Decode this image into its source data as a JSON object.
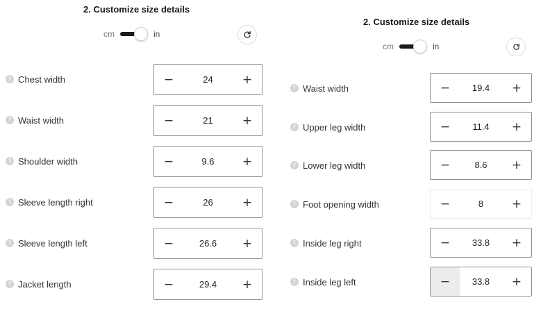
{
  "left": {
    "title": "2. Customize size details",
    "toggle": {
      "left_unit": "cm",
      "right_unit": "in",
      "selected": "in"
    },
    "reset_icon": "refresh-icon",
    "info_icon": "info-icon",
    "fields": [
      {
        "label": "Chest width",
        "value": "24",
        "minus": "−",
        "plus": "+"
      },
      {
        "label": "Waist width",
        "value": "21",
        "minus": "−",
        "plus": "+"
      },
      {
        "label": "Shoulder width",
        "value": "9.6",
        "minus": "−",
        "plus": "+"
      },
      {
        "label": "Sleeve length right",
        "value": "26",
        "minus": "−",
        "plus": "+"
      },
      {
        "label": "Sleeve length left",
        "value": "26.6",
        "minus": "−",
        "plus": "+"
      },
      {
        "label": "Jacket length",
        "value": "29.4",
        "minus": "−",
        "plus": "+"
      }
    ]
  },
  "right": {
    "title": "2. Customize size details",
    "toggle": {
      "left_unit": "cm",
      "right_unit": "in",
      "selected": "in"
    },
    "reset_icon": "refresh-icon",
    "info_icon": "info-icon",
    "fields": [
      {
        "label": "Waist width",
        "value": "19.4",
        "minus": "−",
        "plus": "+"
      },
      {
        "label": "Upper leg width",
        "value": "11.4",
        "minus": "−",
        "plus": "+"
      },
      {
        "label": "Lower leg width",
        "value": "8.6",
        "minus": "−",
        "plus": "+"
      },
      {
        "label": "Foot opening width",
        "value": "8",
        "minus": "−",
        "plus": "+"
      },
      {
        "label": "Inside leg right",
        "value": "33.8",
        "minus": "−",
        "plus": "+"
      },
      {
        "label": "Inside leg left",
        "value": "33.8",
        "minus": "−",
        "plus": "+"
      }
    ]
  }
}
